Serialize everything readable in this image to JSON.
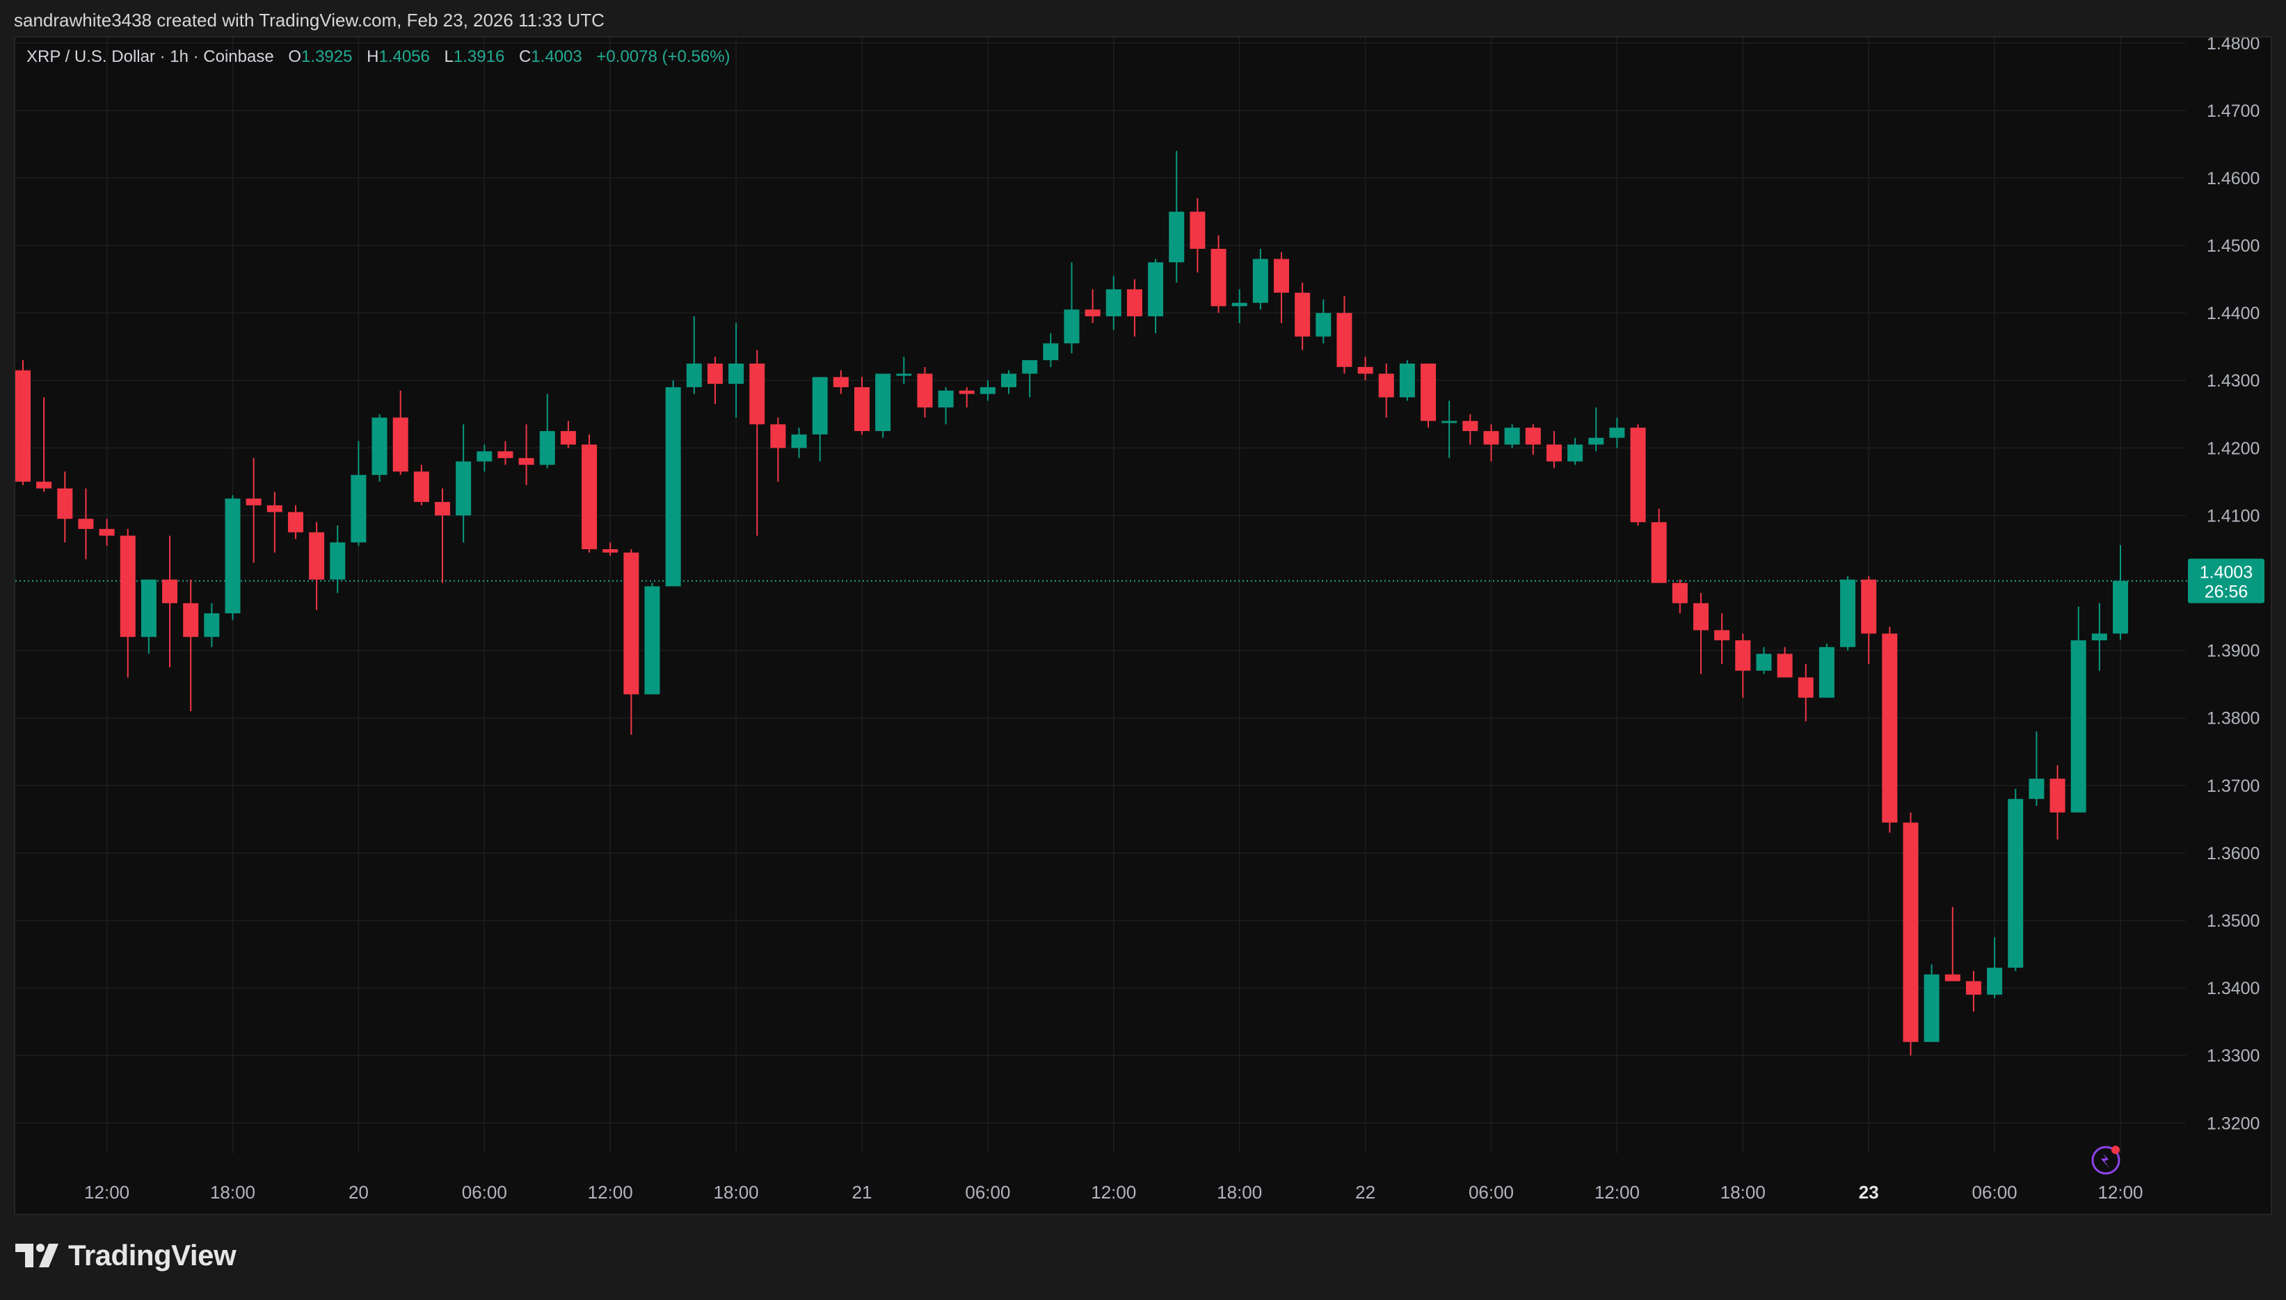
{
  "header": {
    "attribution": "sandrawhite3438 created with TradingView.com, Feb 23, 2026 11:33 UTC"
  },
  "legend": {
    "symbol": "XRP / U.S. Dollar · 1h · Coinbase",
    "open_label": "O",
    "open": "1.3925",
    "high_label": "H",
    "high": "1.4056",
    "low_label": "L",
    "low": "1.3916",
    "close_label": "C",
    "close": "1.4003",
    "change": "+0.0078 (+0.56%)"
  },
  "price_tag": {
    "price": "1.4003",
    "countdown": "26:56"
  },
  "footer": {
    "brand": "TradingView"
  },
  "colors": {
    "up": "#089981",
    "down": "#f23645",
    "background": "#0e0e0e",
    "grid": "#1f1f1f",
    "axis_text": "#b2b5be",
    "price_line": "#22ab94"
  },
  "chart_data": {
    "type": "candlestick",
    "interval": "1h",
    "ylim": [
      1.3155,
      1.4808
    ],
    "y_ticks": [
      "1.4800",
      "1.4700",
      "1.4600",
      "1.4500",
      "1.4400",
      "1.4300",
      "1.4200",
      "1.4100",
      "1.3900",
      "1.3800",
      "1.3700",
      "1.3600",
      "1.3500",
      "1.3400",
      "1.3300",
      "1.3200"
    ],
    "x_ticks": [
      {
        "label": "12:00",
        "bar": 4,
        "bold": false
      },
      {
        "label": "18:00",
        "bar": 10,
        "bold": false
      },
      {
        "label": "20",
        "bar": 16,
        "bold": false
      },
      {
        "label": "06:00",
        "bar": 22,
        "bold": false
      },
      {
        "label": "12:00",
        "bar": 28,
        "bold": false
      },
      {
        "label": "18:00",
        "bar": 34,
        "bold": false
      },
      {
        "label": "21",
        "bar": 40,
        "bold": false
      },
      {
        "label": "06:00",
        "bar": 46,
        "bold": false
      },
      {
        "label": "12:00",
        "bar": 52,
        "bold": false
      },
      {
        "label": "18:00",
        "bar": 58,
        "bold": false
      },
      {
        "label": "22",
        "bar": 64,
        "bold": false
      },
      {
        "label": "06:00",
        "bar": 70,
        "bold": false
      },
      {
        "label": "12:00",
        "bar": 76,
        "bold": false
      },
      {
        "label": "18:00",
        "bar": 82,
        "bold": false
      },
      {
        "label": "23",
        "bar": 88,
        "bold": true
      },
      {
        "label": "06:00",
        "bar": 94,
        "bold": false
      },
      {
        "label": "12:00",
        "bar": 100,
        "bold": false
      }
    ],
    "ohlc": [
      [
        1.4315,
        1.433,
        1.4145,
        1.415
      ],
      [
        1.415,
        1.4275,
        1.4135,
        1.414
      ],
      [
        1.414,
        1.4165,
        1.406,
        1.4095
      ],
      [
        1.4095,
        1.414,
        1.4035,
        1.408
      ],
      [
        1.408,
        1.4095,
        1.4055,
        1.407
      ],
      [
        1.407,
        1.408,
        1.386,
        1.392
      ],
      [
        1.392,
        1.4005,
        1.3895,
        1.4005
      ],
      [
        1.4005,
        1.407,
        1.3875,
        1.397
      ],
      [
        1.397,
        1.4005,
        1.381,
        1.392
      ],
      [
        1.392,
        1.397,
        1.3905,
        1.3955
      ],
      [
        1.3955,
        1.413,
        1.3945,
        1.4125
      ],
      [
        1.4125,
        1.4185,
        1.403,
        1.4115
      ],
      [
        1.4115,
        1.4135,
        1.4045,
        1.4105
      ],
      [
        1.4105,
        1.4115,
        1.4065,
        1.4075
      ],
      [
        1.4075,
        1.409,
        1.396,
        1.4005
      ],
      [
        1.4005,
        1.4085,
        1.3985,
        1.406
      ],
      [
        1.406,
        1.421,
        1.4055,
        1.416
      ],
      [
        1.416,
        1.425,
        1.415,
        1.4245
      ],
      [
        1.4245,
        1.4285,
        1.416,
        1.4165
      ],
      [
        1.4165,
        1.4175,
        1.4115,
        1.412
      ],
      [
        1.412,
        1.414,
        1.4,
        1.41
      ],
      [
        1.41,
        1.4235,
        1.406,
        1.418
      ],
      [
        1.418,
        1.4205,
        1.4165,
        1.4195
      ],
      [
        1.4195,
        1.421,
        1.4175,
        1.4185
      ],
      [
        1.4185,
        1.4235,
        1.4145,
        1.4175
      ],
      [
        1.4175,
        1.428,
        1.417,
        1.4225
      ],
      [
        1.4225,
        1.424,
        1.42,
        1.4205
      ],
      [
        1.4205,
        1.422,
        1.4045,
        1.405
      ],
      [
        1.405,
        1.406,
        1.404,
        1.4045
      ],
      [
        1.4045,
        1.405,
        1.3775,
        1.3835
      ],
      [
        1.3835,
        1.4,
        1.3835,
        1.3995
      ],
      [
        1.3995,
        1.43,
        1.3995,
        1.429
      ],
      [
        1.429,
        1.4395,
        1.428,
        1.4325
      ],
      [
        1.4325,
        1.4335,
        1.4265,
        1.4295
      ],
      [
        1.4295,
        1.4385,
        1.4245,
        1.4325
      ],
      [
        1.4325,
        1.4345,
        1.407,
        1.4235
      ],
      [
        1.4235,
        1.4245,
        1.415,
        1.42
      ],
      [
        1.42,
        1.423,
        1.4185,
        1.422
      ],
      [
        1.422,
        1.43,
        1.418,
        1.4305
      ],
      [
        1.4305,
        1.4315,
        1.428,
        1.429
      ],
      [
        1.429,
        1.4305,
        1.422,
        1.4225
      ],
      [
        1.4225,
        1.431,
        1.4215,
        1.431
      ],
      [
        1.431,
        1.4335,
        1.4295,
        1.431
      ],
      [
        1.431,
        1.432,
        1.4245,
        1.426
      ],
      [
        1.426,
        1.429,
        1.4235,
        1.4285
      ],
      [
        1.4285,
        1.429,
        1.426,
        1.428
      ],
      [
        1.428,
        1.43,
        1.427,
        1.429
      ],
      [
        1.429,
        1.4315,
        1.428,
        1.431
      ],
      [
        1.431,
        1.4325,
        1.4275,
        1.433
      ],
      [
        1.433,
        1.437,
        1.432,
        1.4355
      ],
      [
        1.4355,
        1.4475,
        1.434,
        1.4405
      ],
      [
        1.4405,
        1.4435,
        1.4385,
        1.4395
      ],
      [
        1.4395,
        1.4455,
        1.4375,
        1.4435
      ],
      [
        1.4435,
        1.445,
        1.4365,
        1.4395
      ],
      [
        1.4395,
        1.448,
        1.437,
        1.4475
      ],
      [
        1.4475,
        1.464,
        1.4445,
        1.455
      ],
      [
        1.455,
        1.457,
        1.446,
        1.4495
      ],
      [
        1.4495,
        1.4515,
        1.44,
        1.441
      ],
      [
        1.441,
        1.4435,
        1.4385,
        1.4415
      ],
      [
        1.4415,
        1.4495,
        1.4405,
        1.448
      ],
      [
        1.448,
        1.449,
        1.4385,
        1.443
      ],
      [
        1.443,
        1.4445,
        1.4345,
        1.4365
      ],
      [
        1.4365,
        1.442,
        1.4355,
        1.44
      ],
      [
        1.44,
        1.4425,
        1.431,
        1.432
      ],
      [
        1.432,
        1.4335,
        1.43,
        1.431
      ],
      [
        1.431,
        1.4325,
        1.4245,
        1.4275
      ],
      [
        1.4275,
        1.433,
        1.427,
        1.4325
      ],
      [
        1.4325,
        1.4325,
        1.423,
        1.424
      ],
      [
        1.424,
        1.427,
        1.4185,
        1.424
      ],
      [
        1.424,
        1.425,
        1.4205,
        1.4225
      ],
      [
        1.4225,
        1.4235,
        1.418,
        1.4205
      ],
      [
        1.4205,
        1.4235,
        1.42,
        1.423
      ],
      [
        1.423,
        1.4235,
        1.419,
        1.4205
      ],
      [
        1.4205,
        1.4225,
        1.417,
        1.418
      ],
      [
        1.418,
        1.4215,
        1.4175,
        1.4205
      ],
      [
        1.4205,
        1.426,
        1.4195,
        1.4215
      ],
      [
        1.4215,
        1.4245,
        1.42,
        1.423
      ],
      [
        1.423,
        1.4235,
        1.4085,
        1.409
      ],
      [
        1.409,
        1.411,
        1.4,
        1.4
      ],
      [
        1.4,
        1.4005,
        1.3955,
        1.397
      ],
      [
        1.397,
        1.3985,
        1.3865,
        1.393
      ],
      [
        1.393,
        1.3955,
        1.388,
        1.3915
      ],
      [
        1.3915,
        1.3925,
        1.383,
        1.387
      ],
      [
        1.387,
        1.3905,
        1.3865,
        1.3895
      ],
      [
        1.3895,
        1.3905,
        1.386,
        1.386
      ],
      [
        1.386,
        1.388,
        1.3795,
        1.383
      ],
      [
        1.383,
        1.391,
        1.383,
        1.3905
      ],
      [
        1.3905,
        1.401,
        1.39,
        1.4005
      ],
      [
        1.4005,
        1.401,
        1.388,
        1.3925
      ],
      [
        1.3925,
        1.3935,
        1.363,
        1.3645
      ],
      [
        1.3645,
        1.366,
        1.33,
        1.332
      ],
      [
        1.332,
        1.3435,
        1.332,
        1.342
      ],
      [
        1.342,
        1.352,
        1.341,
        1.341
      ],
      [
        1.341,
        1.3425,
        1.3365,
        1.339
      ],
      [
        1.339,
        1.3475,
        1.3385,
        1.343
      ],
      [
        1.343,
        1.3695,
        1.3425,
        1.368
      ],
      [
        1.368,
        1.378,
        1.367,
        1.371
      ],
      [
        1.371,
        1.373,
        1.362,
        1.366
      ],
      [
        1.366,
        1.3965,
        1.366,
        1.3915
      ],
      [
        1.3915,
        1.397,
        1.387,
        1.3925
      ],
      [
        1.3925,
        1.4056,
        1.3916,
        1.4003
      ]
    ]
  }
}
